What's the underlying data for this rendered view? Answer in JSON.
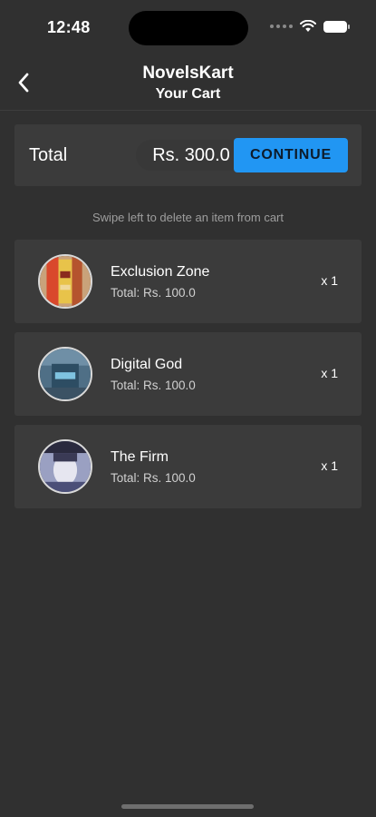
{
  "status_bar": {
    "time": "12:48",
    "icons": [
      "signal-icon",
      "wifi-icon",
      "battery-icon"
    ]
  },
  "app_bar": {
    "title": "NovelsKart",
    "subtitle": "Your Cart",
    "back_icon": "chevron-left-icon"
  },
  "summary": {
    "total_label": "Total",
    "total_value": "Rs. 300.0",
    "continue_label": "CONTINUE"
  },
  "hint": "Swipe left to delete an item from cart",
  "cart_items": [
    {
      "title": "Exclusion Zone",
      "total": "Total: Rs. 100.0",
      "qty": "x 1"
    },
    {
      "title": "Digital God",
      "total": "Total: Rs. 100.0",
      "qty": "x 1"
    },
    {
      "title": "The Firm",
      "total": "Total: Rs. 100.0",
      "qty": "x 1"
    }
  ],
  "colors": {
    "background": "#303030",
    "card": "#3b3b3b",
    "accent": "#2196f3",
    "hint_text": "#9e9e9e"
  }
}
